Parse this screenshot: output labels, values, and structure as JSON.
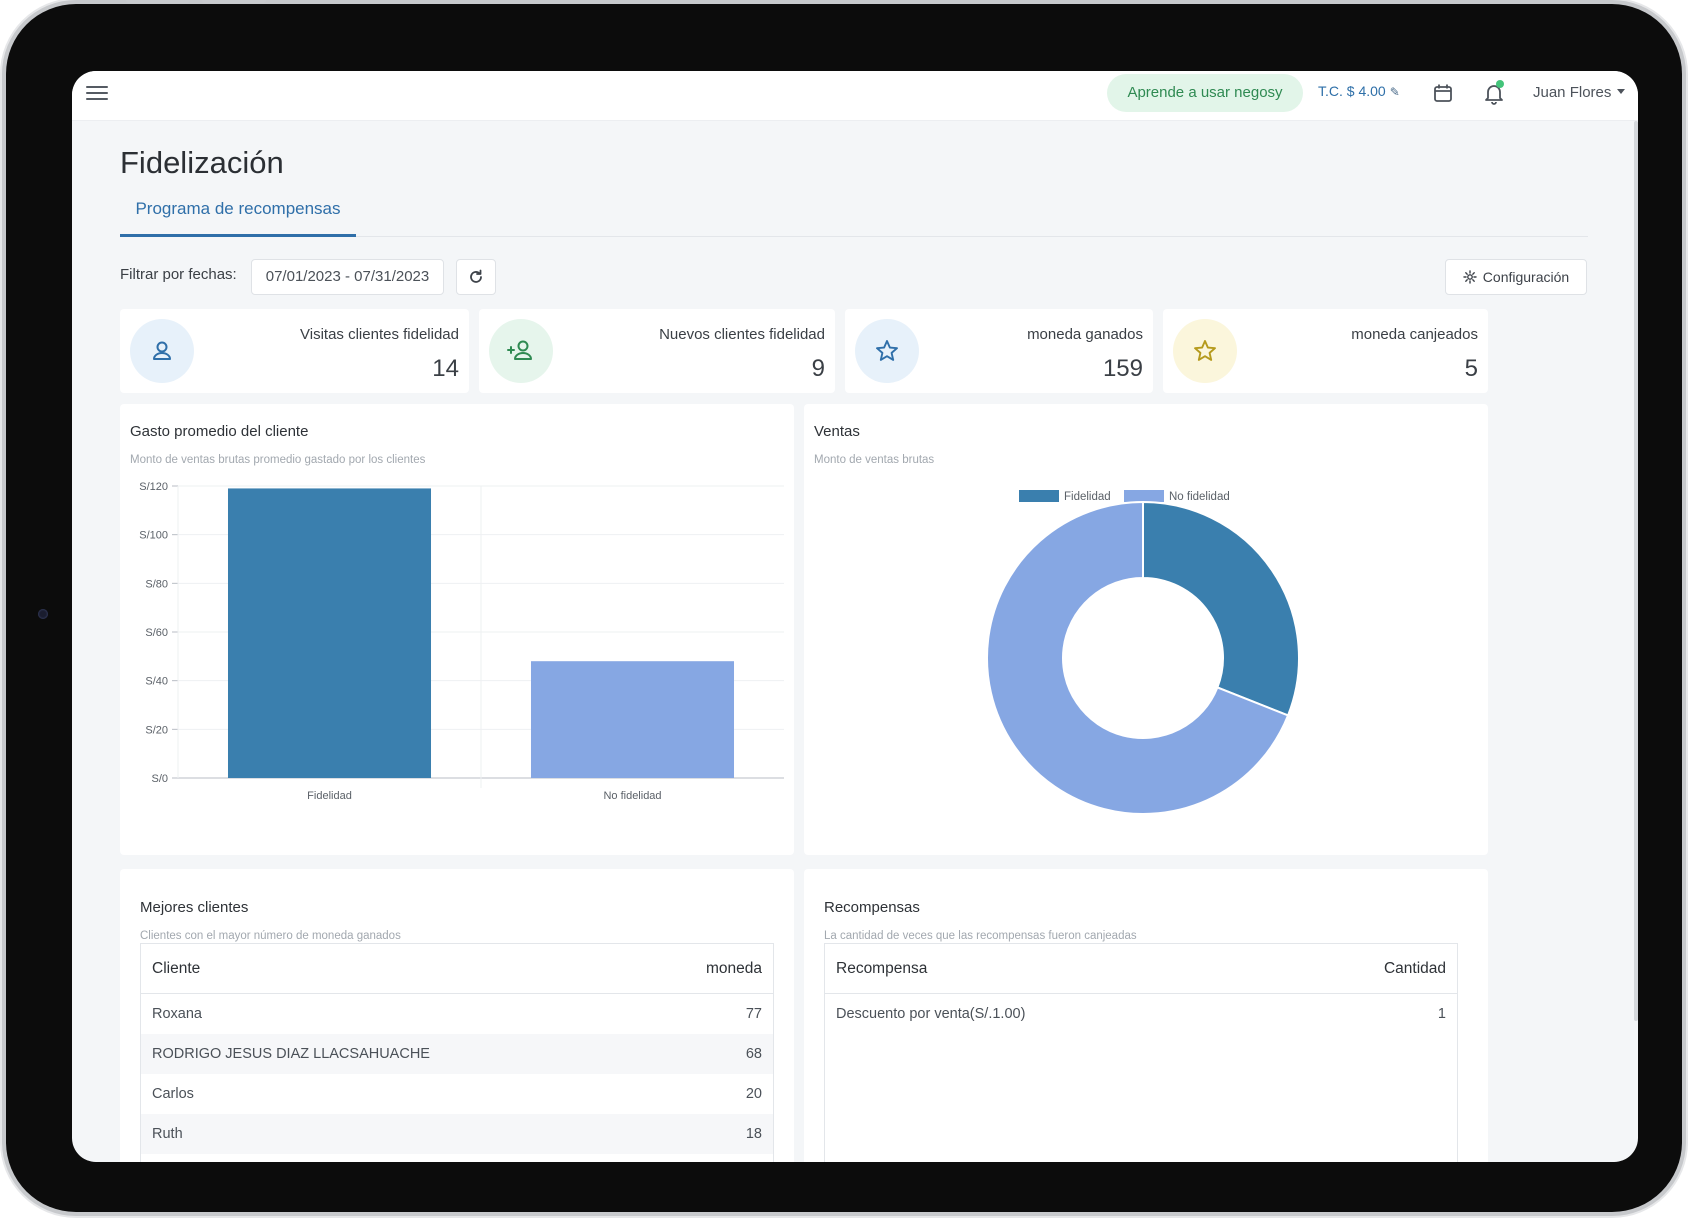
{
  "topbar": {
    "learn_label": "Aprende a usar negosy",
    "exchange_rate": "T.C. $ 4.00",
    "user_name": "Juan Flores"
  },
  "page": {
    "title": "Fidelización",
    "tab_label": "Programa de recompensas"
  },
  "filter": {
    "label": "Filtrar por fechas:",
    "date_range": "07/01/2023 - 07/31/2023",
    "config_label": "Configuración"
  },
  "stats": [
    {
      "label": "Visitas clientes fidelidad",
      "value": "14",
      "icon": "user-icon",
      "color": "#2f6fa9",
      "bg": "#e7f1fa"
    },
    {
      "label": "Nuevos clientes fidelidad",
      "value": "9",
      "icon": "user-plus-icon",
      "color": "#2f8a52",
      "bg": "#e6f5ec"
    },
    {
      "label": "moneda ganados",
      "value": "159",
      "icon": "star-icon",
      "color": "#2f6fa9",
      "bg": "#e7f1fa"
    },
    {
      "label": "moneda canjeados",
      "value": "5",
      "icon": "star-icon",
      "color": "#b59a1c",
      "bg": "#fbf6dc"
    }
  ],
  "bar_panel": {
    "title": "Gasto promedio del cliente",
    "subtitle": "Monto de ventas brutas promedio gastado por los clientes"
  },
  "donut_panel": {
    "title": "Ventas",
    "subtitle": "Monto de ventas brutas"
  },
  "chart_data": [
    {
      "type": "bar",
      "categories": [
        "Fidelidad",
        "No fidelidad"
      ],
      "values": [
        119,
        48
      ],
      "ylim": [
        0,
        120
      ],
      "yticks": [
        "S/0",
        "S/20",
        "S/40",
        "S/60",
        "S/80",
        "S/100",
        "S/120"
      ],
      "ytick_values": [
        0,
        20,
        40,
        60,
        80,
        100,
        120
      ],
      "colors": [
        "#3a7fae",
        "#86a7e3"
      ],
      "grid": true
    },
    {
      "type": "pie",
      "donut": true,
      "categories": [
        "Fidelidad",
        "No fidelidad"
      ],
      "values": [
        31,
        69
      ],
      "colors": [
        "#3a7fae",
        "#86a7e3"
      ],
      "legend": "top"
    }
  ],
  "clients_panel": {
    "title": "Mejores clientes",
    "subtitle": "Clientes con el mayor número de moneda ganados",
    "col_client": "Cliente",
    "col_coins": "moneda",
    "rows": [
      {
        "name": "Roxana",
        "value": "77"
      },
      {
        "name": "RODRIGO JESUS DIAZ LLACSAHUACHE",
        "value": "68"
      },
      {
        "name": "Carlos",
        "value": "20"
      },
      {
        "name": "Ruth",
        "value": "18"
      }
    ]
  },
  "rewards_panel": {
    "title": "Recompensas",
    "subtitle": "La cantidad de veces que las recompensas fueron canjeadas",
    "col_reward": "Recompensa",
    "col_qty": "Cantidad",
    "rows": [
      {
        "name": "Descuento por venta(S/.1.00)",
        "value": "1"
      }
    ]
  }
}
